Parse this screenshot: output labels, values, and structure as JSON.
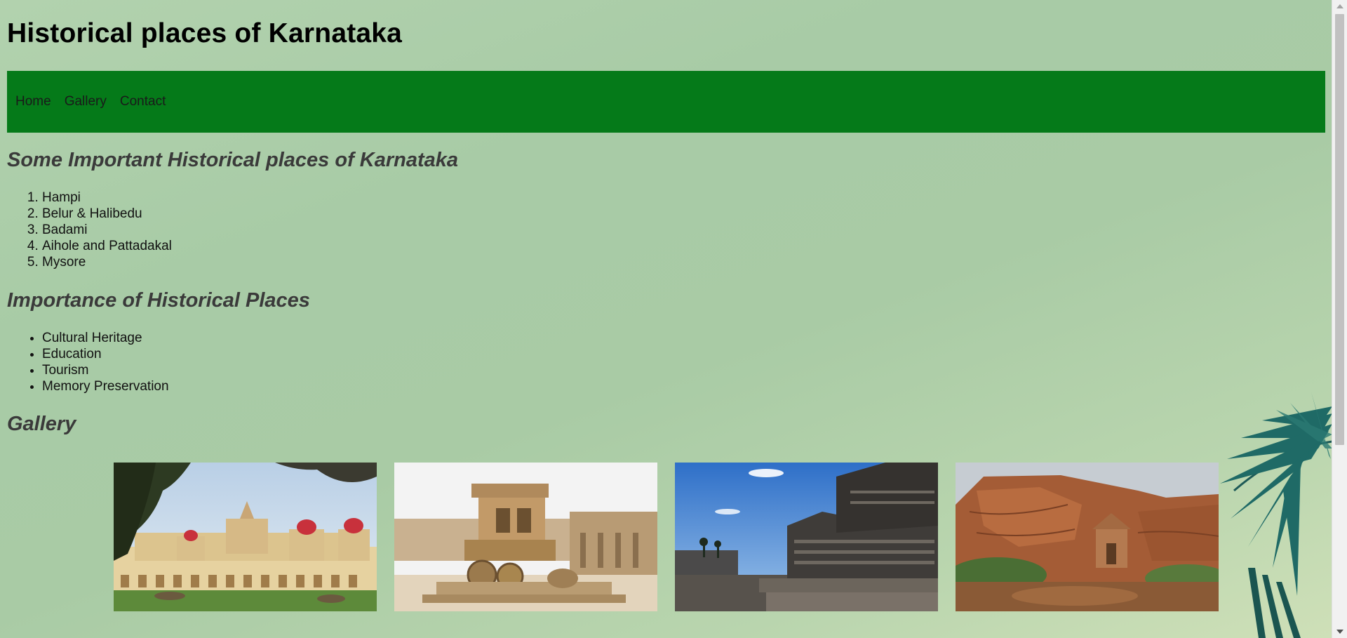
{
  "site_title": "Historical places of Karnataka",
  "nav": {
    "home": "Home",
    "gallery": "Gallery",
    "contact": "Contact",
    "bar_color": "#057a19"
  },
  "sections": {
    "places_heading": "Some Important Historical places of Karnataka",
    "places": [
      "Hampi",
      "Belur & Halibedu",
      "Badami",
      "Aihole and Pattadakal",
      "Mysore"
    ],
    "importance_heading": "Importance of Historical Places",
    "importance": [
      "Cultural Heritage",
      "Education",
      "Tourism",
      "Memory Preservation"
    ],
    "gallery_heading": "Gallery"
  },
  "gallery": [
    {
      "icon": "mysore-palace-photo"
    },
    {
      "icon": "hampi-stone-chariot-photo"
    },
    {
      "icon": "belur-halebidu-temple-photo"
    },
    {
      "icon": "badami-cliff-temple-photo"
    }
  ],
  "colors": {
    "background": "#a9cba5",
    "heading_text": "#3a3a3a"
  }
}
